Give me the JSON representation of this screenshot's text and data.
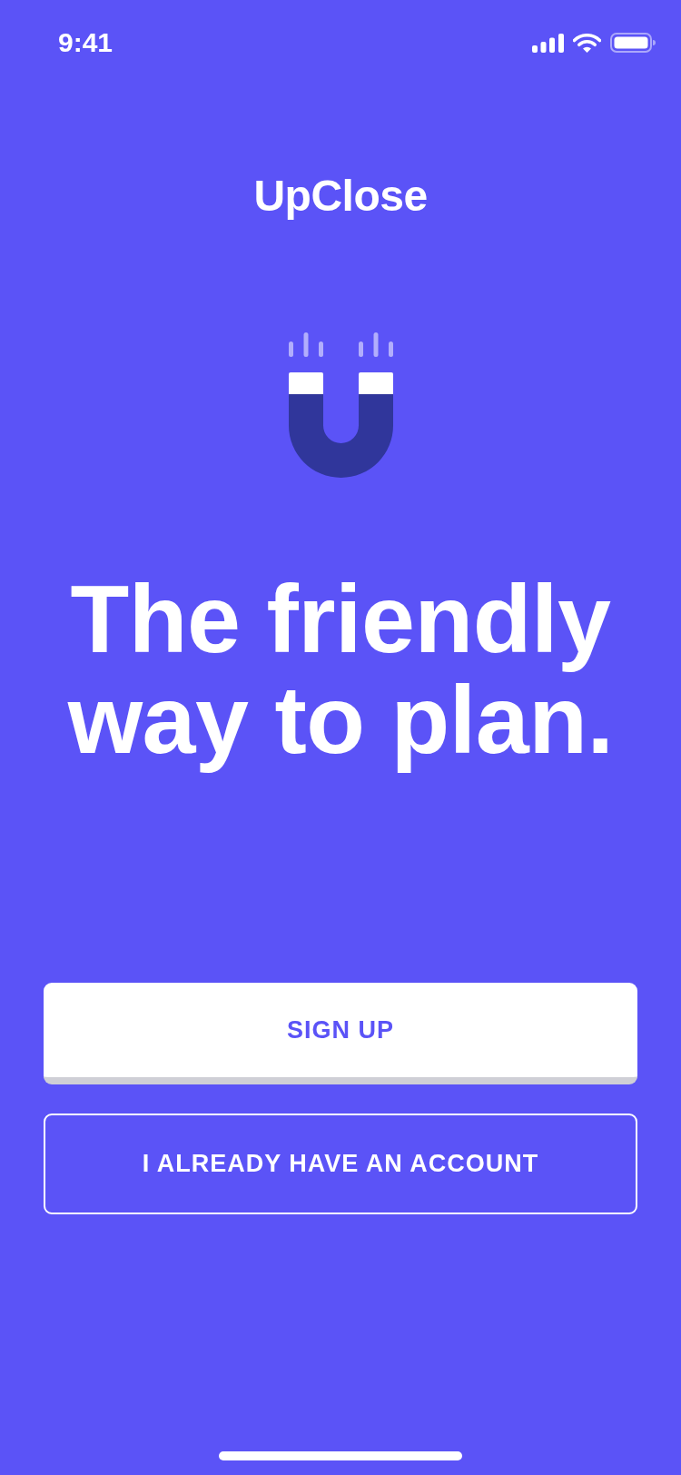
{
  "status_bar": {
    "time": "9:41"
  },
  "app": {
    "name": "UpClose"
  },
  "headline": "The friendly way to plan.",
  "buttons": [
    {
      "label": "SIGN UP",
      "kind": "primary"
    },
    {
      "label": "I ALREADY HAVE AN ACCOUNT",
      "kind": "outline"
    }
  ]
}
